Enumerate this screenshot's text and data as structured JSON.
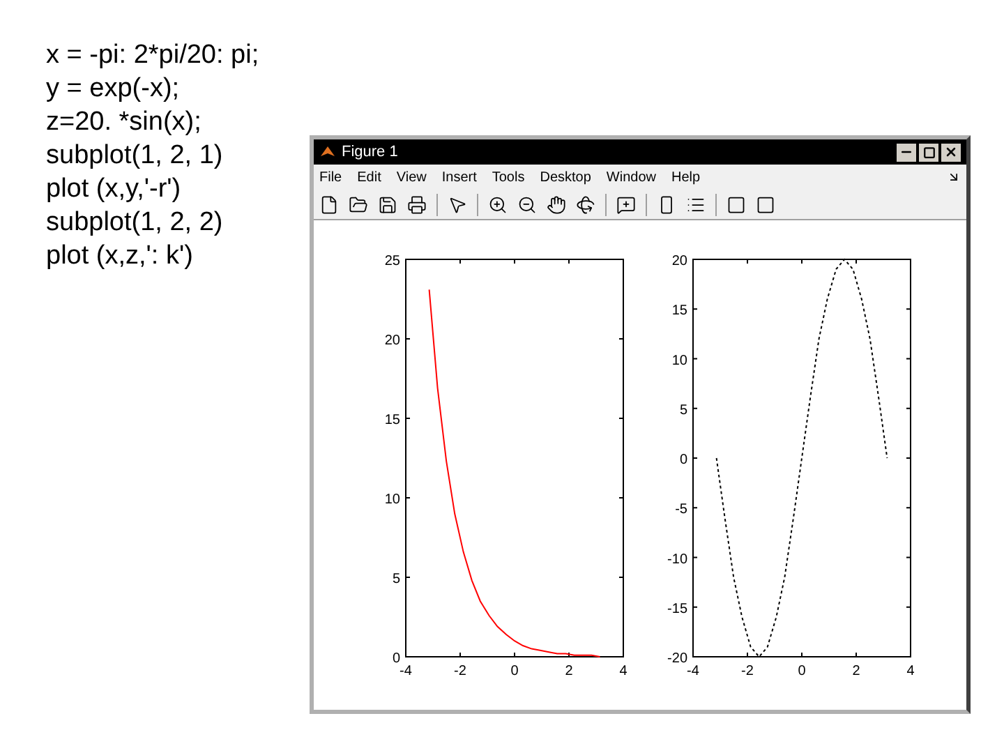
{
  "code_lines": [
    "x = -pi: 2*pi/20: pi;",
    "y = exp(-x);",
    "z=20. *sin(x);",
    "subplot(1, 2, 1)",
    "plot (x,y,'-r')",
    "subplot(1, 2, 2)",
    "plot (x,z,': k')"
  ],
  "window": {
    "title": "Figure 1",
    "menu": [
      "File",
      "Edit",
      "View",
      "Insert",
      "Tools",
      "Desktop",
      "Window",
      "Help"
    ]
  },
  "plots": [
    {
      "chart_data": {
        "type": "line",
        "x": [
          -3.14,
          -2.83,
          -2.51,
          -2.2,
          -1.88,
          -1.57,
          -1.26,
          -0.94,
          -0.63,
          -0.31,
          0,
          0.31,
          0.63,
          0.94,
          1.26,
          1.57,
          1.88,
          2.2,
          2.51,
          2.83,
          3.14
        ],
        "series": [
          {
            "color": "#ff0000",
            "line_style": "solid",
            "values": [
              23.1,
              16.9,
              12.3,
              9,
              6.6,
              4.8,
              3.5,
              2.6,
              1.9,
              1.4,
              1,
              0.7,
              0.5,
              0.4,
              0.3,
              0.2,
              0.2,
              0.1,
              0.1,
              0.1,
              0
            ]
          }
        ],
        "xlim": [
          -4,
          4
        ],
        "ylim": [
          0,
          25
        ],
        "xticks": [
          -4,
          -2,
          0,
          2,
          4
        ],
        "yticks": [
          0,
          5,
          10,
          15,
          20,
          25
        ]
      }
    },
    {
      "chart_data": {
        "type": "line",
        "x": [
          -3.14,
          -2.83,
          -2.51,
          -2.2,
          -1.88,
          -1.57,
          -1.26,
          -0.94,
          -0.63,
          -0.31,
          0,
          0.31,
          0.63,
          0.94,
          1.26,
          1.57,
          1.88,
          2.2,
          2.51,
          2.83,
          3.14
        ],
        "series": [
          {
            "color": "#000000",
            "line_style": "dashed",
            "values": [
              0,
              -6,
              -12,
              -16,
              -19,
              -20,
              -19,
              -16,
              -12,
              -6,
              0,
              6,
              12,
              16,
              19,
              20,
              19,
              16,
              12,
              6,
              0
            ]
          }
        ],
        "xlim": [
          -4,
          4
        ],
        "ylim": [
          -20,
          20
        ],
        "xticks": [
          -4,
          -2,
          0,
          2,
          4
        ],
        "yticks": [
          -20,
          -15,
          -10,
          -5,
          0,
          5,
          10,
          15,
          20
        ]
      }
    }
  ]
}
